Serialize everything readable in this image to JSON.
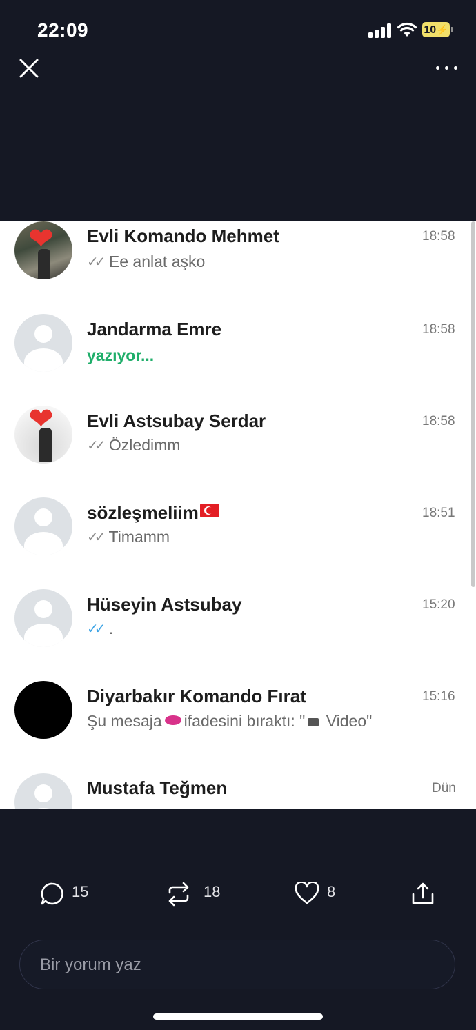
{
  "status_bar": {
    "time": "22:09",
    "battery": "10"
  },
  "top_bar": {
    "close_icon": "close-icon",
    "more_icon": "more-icon"
  },
  "chat_list": {
    "chats": [
      {
        "name": "Evli Komando Mehmet",
        "time": "18:58",
        "preview": "Ee anlat aşko",
        "ticks": "✓✓"
      },
      {
        "name": "Jandarma Emre",
        "time": "18:58",
        "preview": "yazıyor..."
      },
      {
        "name": "Evli Astsubay Serdar",
        "time": "18:58",
        "preview": "Özledimm",
        "ticks": "✓✓"
      },
      {
        "name": "sözleşmeliim",
        "time": "18:51",
        "preview": "Timamm",
        "ticks": "✓✓"
      },
      {
        "name": "Hüseyin Astsubay",
        "time": "15:20",
        "preview": ".",
        "ticks": "✓✓"
      },
      {
        "name": "Diyarbakır Komando Fırat",
        "time": "15:16",
        "preview_a": "Şu mesaja",
        "preview_b": "ifadesini bıraktı: \"",
        "preview_c": " Video\""
      },
      {
        "name": "Mustafa Teğmen",
        "time": "Dün"
      }
    ]
  },
  "actions": {
    "replies": "15",
    "reposts": "18",
    "likes": "8"
  },
  "comment": {
    "placeholder": "Bir yorum yaz"
  },
  "colors": {
    "background": "#151824",
    "typing_green": "#1fae6a",
    "read_tick_blue": "#3ba3e5",
    "heart_red": "#e8342f"
  }
}
